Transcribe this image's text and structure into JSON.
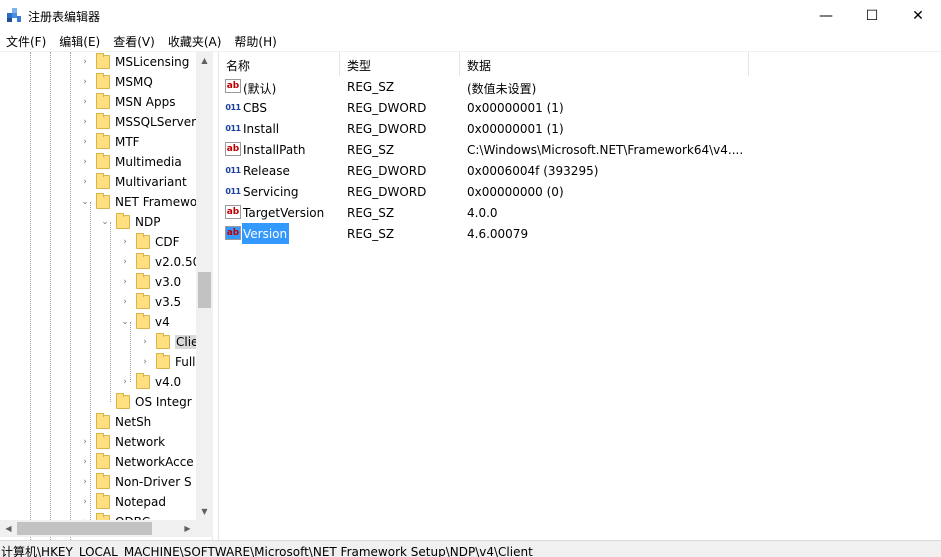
{
  "window": {
    "title": "注册表编辑器"
  },
  "window_controls": {
    "minimize": "—",
    "maximize": "☐",
    "close": "✕"
  },
  "menu": [
    "文件(F)",
    "编辑(E)",
    "查看(V)",
    "收藏夹(A)",
    "帮助(H)"
  ],
  "tree": {
    "items": [
      {
        "label": "MSLicensing",
        "expander": "›"
      },
      {
        "label": "MSMQ",
        "expander": "›"
      },
      {
        "label": "MSN Apps",
        "expander": "›"
      },
      {
        "label": "MSSQLServer",
        "expander": "›"
      },
      {
        "label": "MTF",
        "expander": "›"
      },
      {
        "label": "Multimedia",
        "expander": "›"
      },
      {
        "label": "Multivariant",
        "expander": "›"
      },
      {
        "label": "NET Framewo",
        "expander": "⌄"
      },
      {
        "label": "NDP",
        "expander": "⌄"
      },
      {
        "label": "CDF",
        "expander": "›"
      },
      {
        "label": "v2.0.50",
        "expander": "›"
      },
      {
        "label": "v3.0",
        "expander": "›"
      },
      {
        "label": "v3.5",
        "expander": "›"
      },
      {
        "label": "v4",
        "expander": "⌄"
      },
      {
        "label": "Clie",
        "expander": "›"
      },
      {
        "label": "Full",
        "expander": "›"
      },
      {
        "label": "v4.0",
        "expander": "›"
      },
      {
        "label": "OS Integr",
        "expander": ""
      },
      {
        "label": "NetSh",
        "expander": ""
      },
      {
        "label": "Network",
        "expander": "›"
      },
      {
        "label": "NetworkAcce",
        "expander": "›"
      },
      {
        "label": "Non-Driver S",
        "expander": "›"
      },
      {
        "label": "Notepad",
        "expander": "›"
      },
      {
        "label": "ODBC",
        "expander": "›"
      }
    ],
    "selected": "Clie"
  },
  "scroll": {
    "up": "▲",
    "down": "▼",
    "left": "◀",
    "right": "▶"
  },
  "list": {
    "columns": [
      "名称",
      "类型",
      "数据"
    ],
    "rows": [
      {
        "icon": "string-value-icon",
        "icon_text": "ab",
        "name": "(默认)",
        "type": "REG_SZ",
        "data": "(数值未设置)"
      },
      {
        "icon": "dword-value-icon",
        "icon_text": "011",
        "name": "CBS",
        "type": "REG_DWORD",
        "data": "0x00000001 (1)"
      },
      {
        "icon": "dword-value-icon",
        "icon_text": "011",
        "name": "Install",
        "type": "REG_DWORD",
        "data": "0x00000001 (1)"
      },
      {
        "icon": "string-value-icon",
        "icon_text": "ab",
        "name": "InstallPath",
        "type": "REG_SZ",
        "data": "C:\\Windows\\Microsoft.NET\\Framework64\\v4...."
      },
      {
        "icon": "dword-value-icon",
        "icon_text": "011",
        "name": "Release",
        "type": "REG_DWORD",
        "data": "0x0006004f (393295)"
      },
      {
        "icon": "dword-value-icon",
        "icon_text": "011",
        "name": "Servicing",
        "type": "REG_DWORD",
        "data": "0x00000000 (0)"
      },
      {
        "icon": "string-value-icon",
        "icon_text": "ab",
        "name": "TargetVersion",
        "type": "REG_SZ",
        "data": "4.0.0"
      },
      {
        "icon": "string-value-icon",
        "icon_text": "ab",
        "name": "Version",
        "type": "REG_SZ",
        "data": "4.6.00079"
      }
    ],
    "selected": "Version"
  },
  "status": {
    "path": "计算机\\HKEY_LOCAL_MACHINE\\SOFTWARE\\Microsoft\\NET Framework Setup\\NDP\\v4\\Client"
  },
  "colors": {
    "selection": "#3399ff",
    "folder": "#ffdf80",
    "string_icon": "#c00000",
    "dword_icon": "#1b3f9e"
  }
}
